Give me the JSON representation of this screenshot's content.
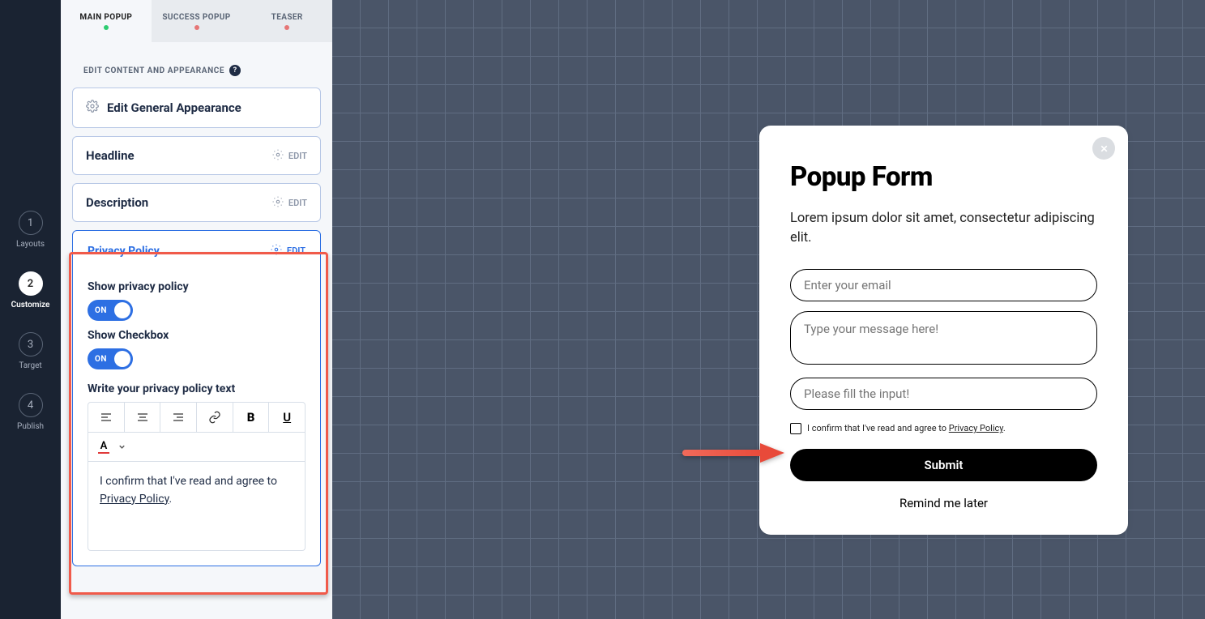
{
  "rail": {
    "steps": [
      {
        "num": "1",
        "label": "Layouts"
      },
      {
        "num": "2",
        "label": "Customize"
      },
      {
        "num": "3",
        "label": "Target"
      },
      {
        "num": "4",
        "label": "Publish"
      }
    ],
    "active_index": 1
  },
  "sidebar": {
    "tabs": [
      {
        "label": "MAIN POPUP",
        "dot": "green",
        "active": true
      },
      {
        "label": "SUCCESS POPUP",
        "dot": "red",
        "active": false
      },
      {
        "label": "TEASER",
        "dot": "red",
        "active": false
      }
    ],
    "section_label": "EDIT CONTENT AND APPEARANCE",
    "cards": {
      "general": "Edit General Appearance",
      "headline": "Headline",
      "description": "Description",
      "privacy": {
        "title": "Privacy Policy",
        "show_policy_label": "Show privacy policy",
        "show_policy_value": "ON",
        "show_checkbox_label": "Show Checkbox",
        "show_checkbox_value": "ON",
        "rte_label": "Write your privacy policy text",
        "rte_text_before": "I confirm that I've read and agree to ",
        "rte_link_text": "Privacy Policy",
        "rte_text_after": "."
      }
    },
    "edit_label": "EDIT"
  },
  "popup": {
    "title": "Popup Form",
    "desc": "Lorem ipsum dolor sit amet, consectetur adipiscing elit.",
    "email_placeholder": "Enter your email",
    "message_placeholder": "Type your message here!",
    "third_placeholder": "Please fill the input!",
    "consent_text_before": "I confirm that I've read and agree to ",
    "consent_link": "Privacy Policy",
    "consent_text_after": ".",
    "submit_label": "Submit",
    "later_label": "Remind me later"
  }
}
